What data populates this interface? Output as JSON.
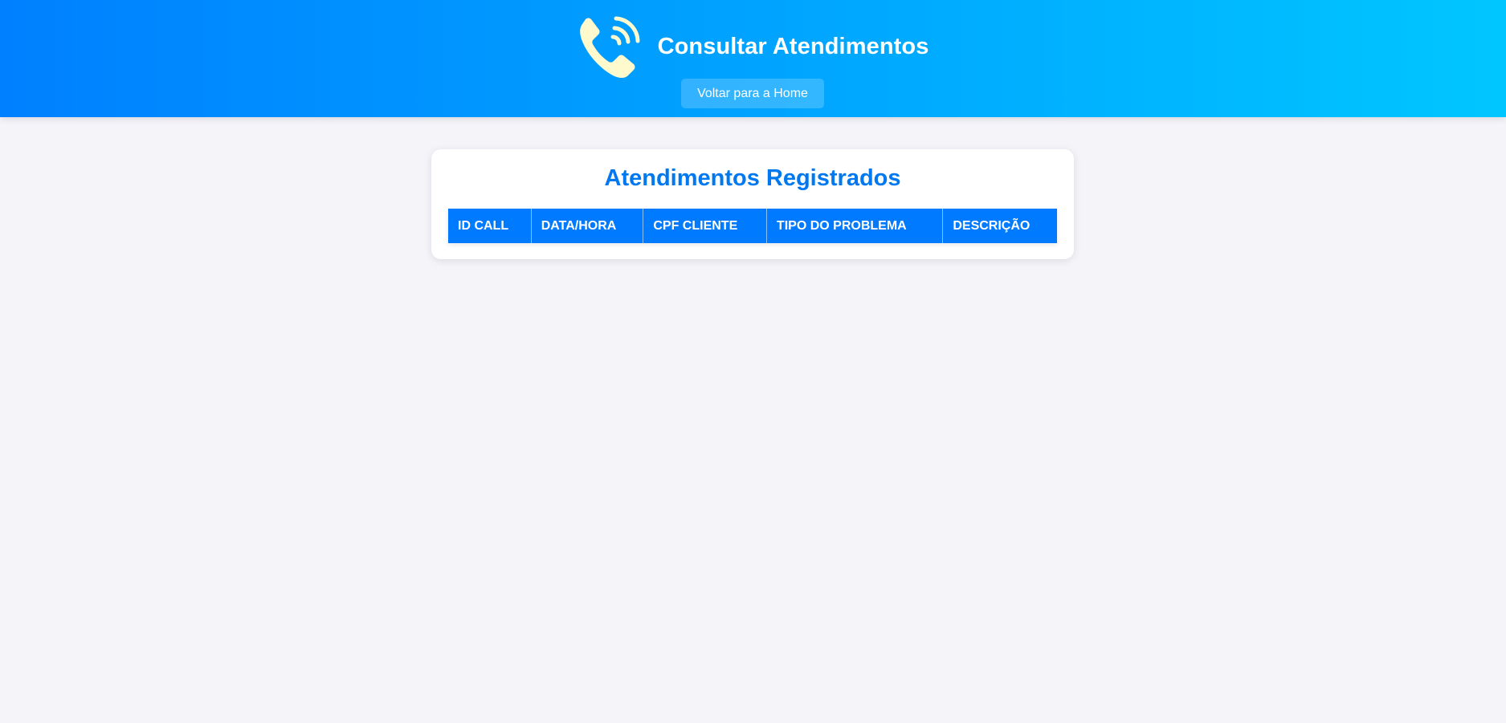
{
  "header": {
    "title": "Consultar Atendimentos",
    "icon": "phone-ringing-icon",
    "home_button_label": "Voltar para a Home"
  },
  "main": {
    "title": "Atendimentos Registrados",
    "table": {
      "columns": [
        "ID CALL",
        "DATA/HORA",
        "CPF CLIENTE",
        "TIPO DO PROBLEMA",
        "DESCRIÇÃO"
      ],
      "rows": []
    }
  },
  "colors": {
    "header_gradient_start": "#0080ff",
    "header_gradient_end": "#00c6ff",
    "accent": "#007bff",
    "icon": "#fffacd",
    "background": "#f4f4f9"
  }
}
